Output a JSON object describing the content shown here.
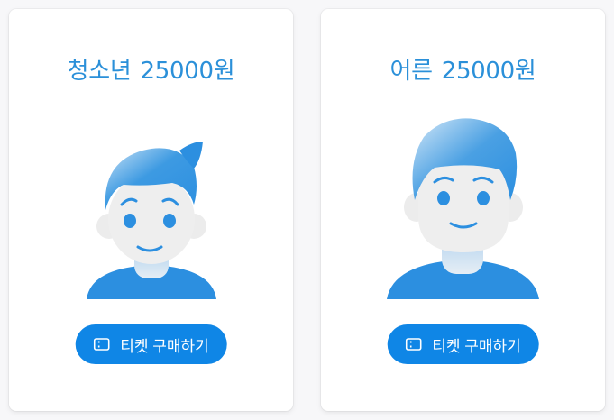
{
  "cards": [
    {
      "category": "청소년",
      "price": "25000원",
      "button_label": "티켓 구매하기",
      "avatar_icon": "youth-avatar-icon",
      "button_icon": "ticket-icon"
    },
    {
      "category": "어른",
      "price": "25000원",
      "button_label": "티켓 구매하기",
      "avatar_icon": "adult-avatar-icon",
      "button_icon": "ticket-icon"
    }
  ],
  "colors": {
    "accent_text": "#2b90d9",
    "button_bg": "#0f86e6",
    "avatar_blue": "#2c8fe0",
    "skin": "#eeeeee"
  }
}
